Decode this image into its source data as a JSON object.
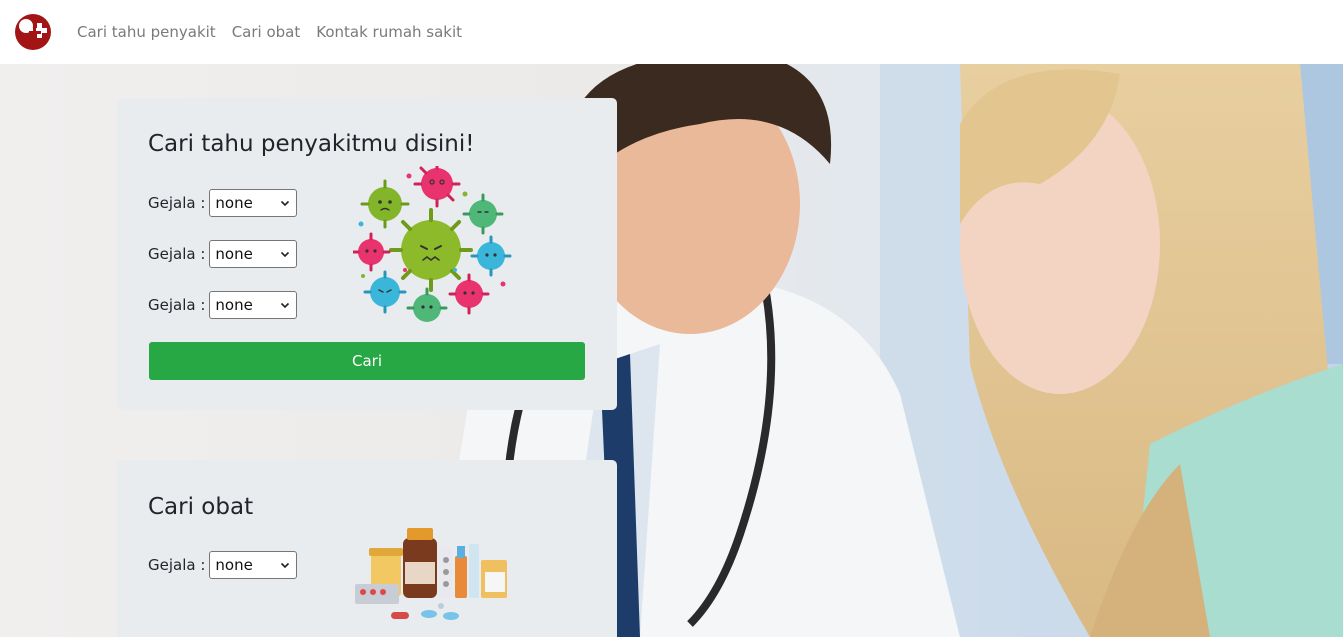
{
  "navbar": {
    "links": [
      {
        "label": "Cari tahu penyakit"
      },
      {
        "label": "Cari obat"
      },
      {
        "label": "Kontak rumah sakit"
      }
    ]
  },
  "disease_card": {
    "title": "Cari tahu penyakitmu disini!",
    "fields": [
      {
        "label": "Gejala :",
        "value": "none"
      },
      {
        "label": "Gejala :",
        "value": "none"
      },
      {
        "label": "Gejala :",
        "value": "none"
      }
    ],
    "button_label": "Cari",
    "illustration_icon": "virus-illustration"
  },
  "medicine_card": {
    "title": "Cari obat",
    "fields": [
      {
        "label": "Gejala :",
        "value": "none"
      }
    ],
    "illustration_icon": "medicine-illustration"
  },
  "colors": {
    "brand": "#b31b1b",
    "button": "#28a745",
    "card_bg": "#e9ecef"
  }
}
